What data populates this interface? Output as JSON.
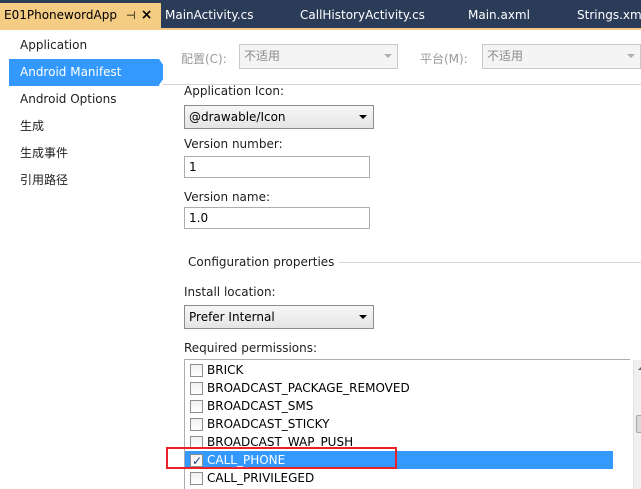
{
  "tabs": [
    {
      "label": "E01PhonewordApp",
      "active": true,
      "pin": "⊣",
      "close": "×"
    },
    {
      "label": "MainActivity.cs",
      "active": false
    },
    {
      "label": "CallHistoryActivity.cs",
      "active": false
    },
    {
      "label": "Main.axml",
      "active": false
    },
    {
      "label": "Strings.xml",
      "active": false
    }
  ],
  "nav": {
    "items": [
      {
        "label": "Application",
        "selected": false
      },
      {
        "label": "Android Manifest",
        "selected": true
      },
      {
        "label": "Android Options",
        "selected": false
      },
      {
        "label": "生成",
        "selected": false
      },
      {
        "label": "生成事件",
        "selected": false
      },
      {
        "label": "引用路径",
        "selected": false
      }
    ]
  },
  "config": {
    "configuration_label": "配置(C):",
    "configuration_value": "不适用",
    "platform_label": "平台(M):",
    "platform_value": "不适用"
  },
  "form": {
    "app_icon_label": "Application Icon:",
    "app_icon_value": "@drawable/Icon",
    "version_number_label": "Version number:",
    "version_number_value": "1",
    "version_name_label": "Version name:",
    "version_name_value": "1.0",
    "config_properties_title": "Configuration properties",
    "install_location_label": "Install location:",
    "install_location_value": "Prefer Internal",
    "required_permissions_label": "Required permissions:"
  },
  "permissions": [
    {
      "name": "BRICK",
      "checked": false,
      "selected": false
    },
    {
      "name": "BROADCAST_PACKAGE_REMOVED",
      "checked": false,
      "selected": false
    },
    {
      "name": "BROADCAST_SMS",
      "checked": false,
      "selected": false
    },
    {
      "name": "BROADCAST_STICKY",
      "checked": false,
      "selected": false
    },
    {
      "name": "BROADCAST_WAP_PUSH",
      "checked": false,
      "selected": false
    },
    {
      "name": "CALL_PHONE",
      "checked": true,
      "selected": true
    },
    {
      "name": "CALL_PRIVILEGED",
      "checked": false,
      "selected": false
    }
  ],
  "colors": {
    "tabstrip_bg": "#2b3c59",
    "active_tab": "#f5cc84",
    "selection": "#3399ff",
    "highlight_border": "#e8212a"
  }
}
